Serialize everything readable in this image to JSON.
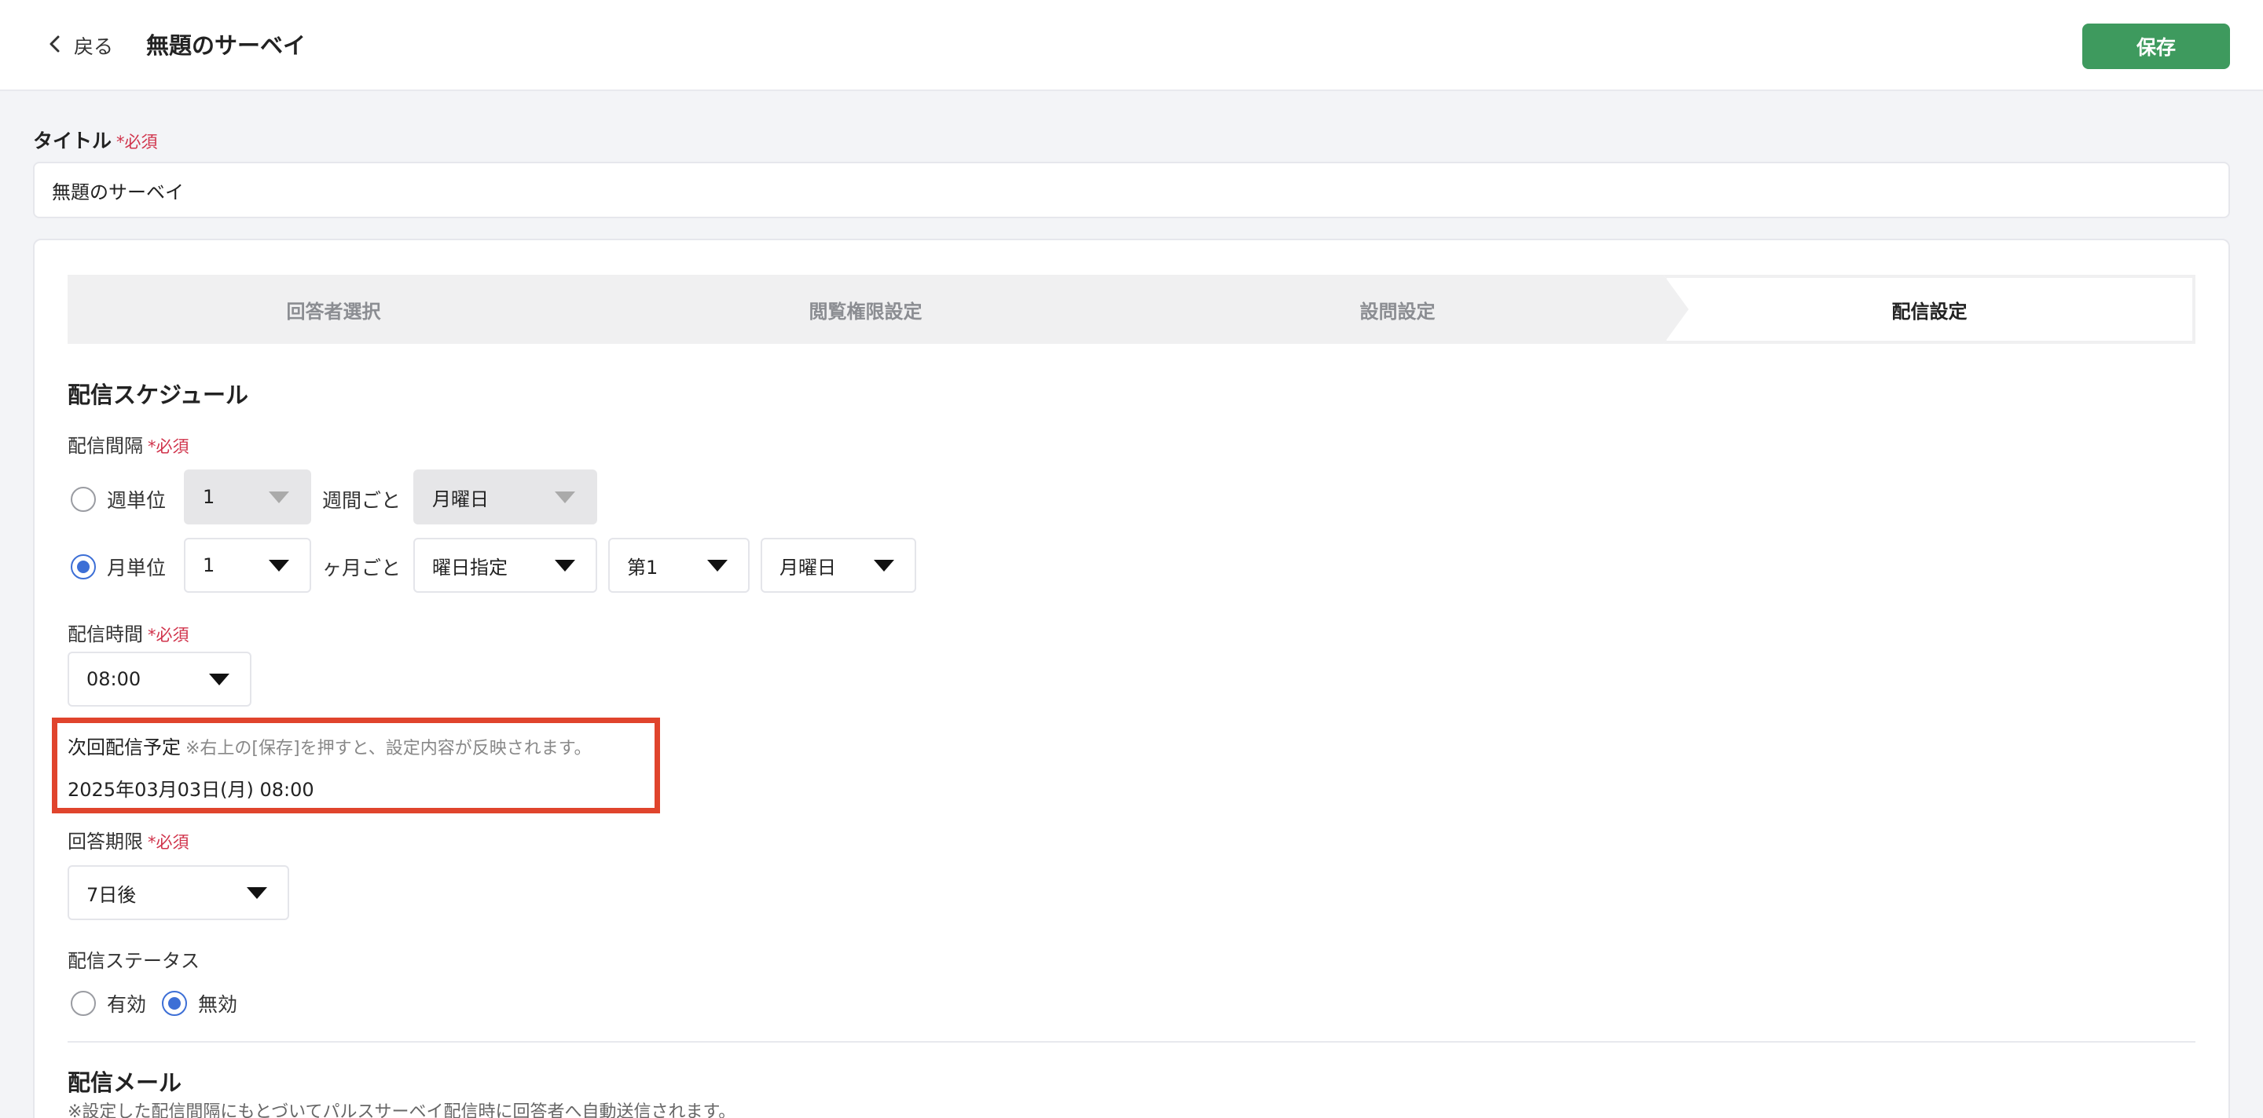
{
  "header": {
    "back_label": "戻る",
    "title": "無題のサーベイ",
    "save_label": "保存"
  },
  "title_field": {
    "label": "タイトル",
    "required": "*必須",
    "value": "無題のサーベイ"
  },
  "steps": [
    {
      "label": "回答者選択",
      "active": false
    },
    {
      "label": "閲覧権限設定",
      "active": false
    },
    {
      "label": "設問設定",
      "active": false
    },
    {
      "label": "配信設定",
      "active": true
    }
  ],
  "schedule": {
    "section_title": "配信スケジュール",
    "interval": {
      "label": "配信間隔",
      "required": "*必須",
      "weekly": {
        "label": "週単位",
        "selected": false,
        "count": "1",
        "unit_text": "週間ごと",
        "weekday": "月曜日"
      },
      "monthly": {
        "label": "月単位",
        "selected": true,
        "count": "1",
        "unit_text": "ヶ月ごと",
        "mode": "曜日指定",
        "week_number": "第1",
        "weekday": "月曜日"
      }
    },
    "time": {
      "label": "配信時間",
      "required": "*必須",
      "value": "08:00"
    },
    "next": {
      "label": "次回配信予定",
      "note": "※右上の[保存]を押すと、設定内容が反映されます。",
      "value": "2025年03月03日(月) 08:00"
    },
    "deadline": {
      "label": "回答期限",
      "required": "*必須",
      "value": "7日後"
    },
    "status": {
      "label": "配信ステータス",
      "options": [
        {
          "label": "有効",
          "selected": false
        },
        {
          "label": "無効",
          "selected": true
        }
      ]
    }
  },
  "mail": {
    "section_title": "配信メール",
    "note": "※設定した配信間隔にもとづいてパルスサーベイ配信時に回答者へ自動送信されます。"
  },
  "colors": {
    "save_button": "#3e9a5e",
    "radio_selected": "#3d6fd6",
    "required": "#d0334b",
    "highlight": "#e0442d"
  }
}
